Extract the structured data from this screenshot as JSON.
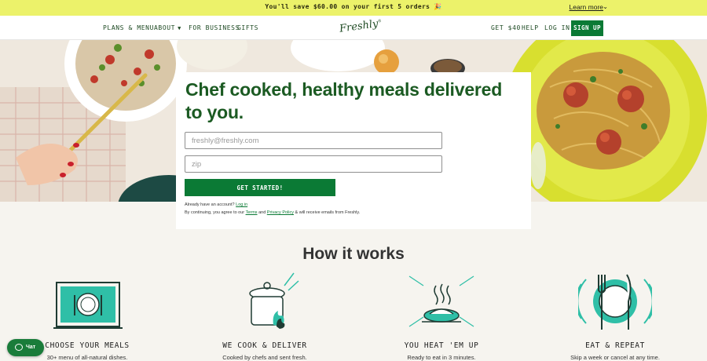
{
  "promo": {
    "text": "You'll save $60.00 on your first 5 orders 🎉",
    "learn_more": "Learn more",
    "chevron": "⌄"
  },
  "nav": {
    "left": [
      "PLANS & MENU",
      "ABOUT",
      "FOR BUSINESS",
      "GIFTS"
    ],
    "logo": "Freshly",
    "right": [
      "GET $40",
      "HELP",
      "LOG IN"
    ],
    "signup": "SIGN UP"
  },
  "hero": {
    "title": "Chef cooked, healthy meals delivered to you.",
    "email_placeholder": "freshly@freshly.com",
    "zip_placeholder": "zip",
    "cta": "GET STARTED!",
    "account_prefix": "Already have an account? ",
    "login_link": "Log in",
    "terms_prefix": "By continuing, you agree to our ",
    "terms_link": "Terms",
    "and_text": " and ",
    "privacy_link": "Privacy Policy",
    "terms_suffix": " & will receive emails from Freshly."
  },
  "how": {
    "title": "How it works",
    "steps": [
      {
        "title": "CHOOSE YOUR MEALS",
        "desc": "30+ menu of all-natural dishes."
      },
      {
        "title": "WE COOK & DELIVER",
        "desc": "Cooked by chefs and sent fresh."
      },
      {
        "title": "YOU HEAT 'EM UP",
        "desc": "Ready to eat in 3 minutes."
      },
      {
        "title": "EAT & REPEAT",
        "desc": "Skip a week or cancel at any time."
      }
    ]
  },
  "chat": {
    "label": "Чат"
  },
  "colors": {
    "brand_green": "#0b7a35",
    "promo_yellow": "#ecf26a",
    "title_green": "#1b5a22"
  }
}
